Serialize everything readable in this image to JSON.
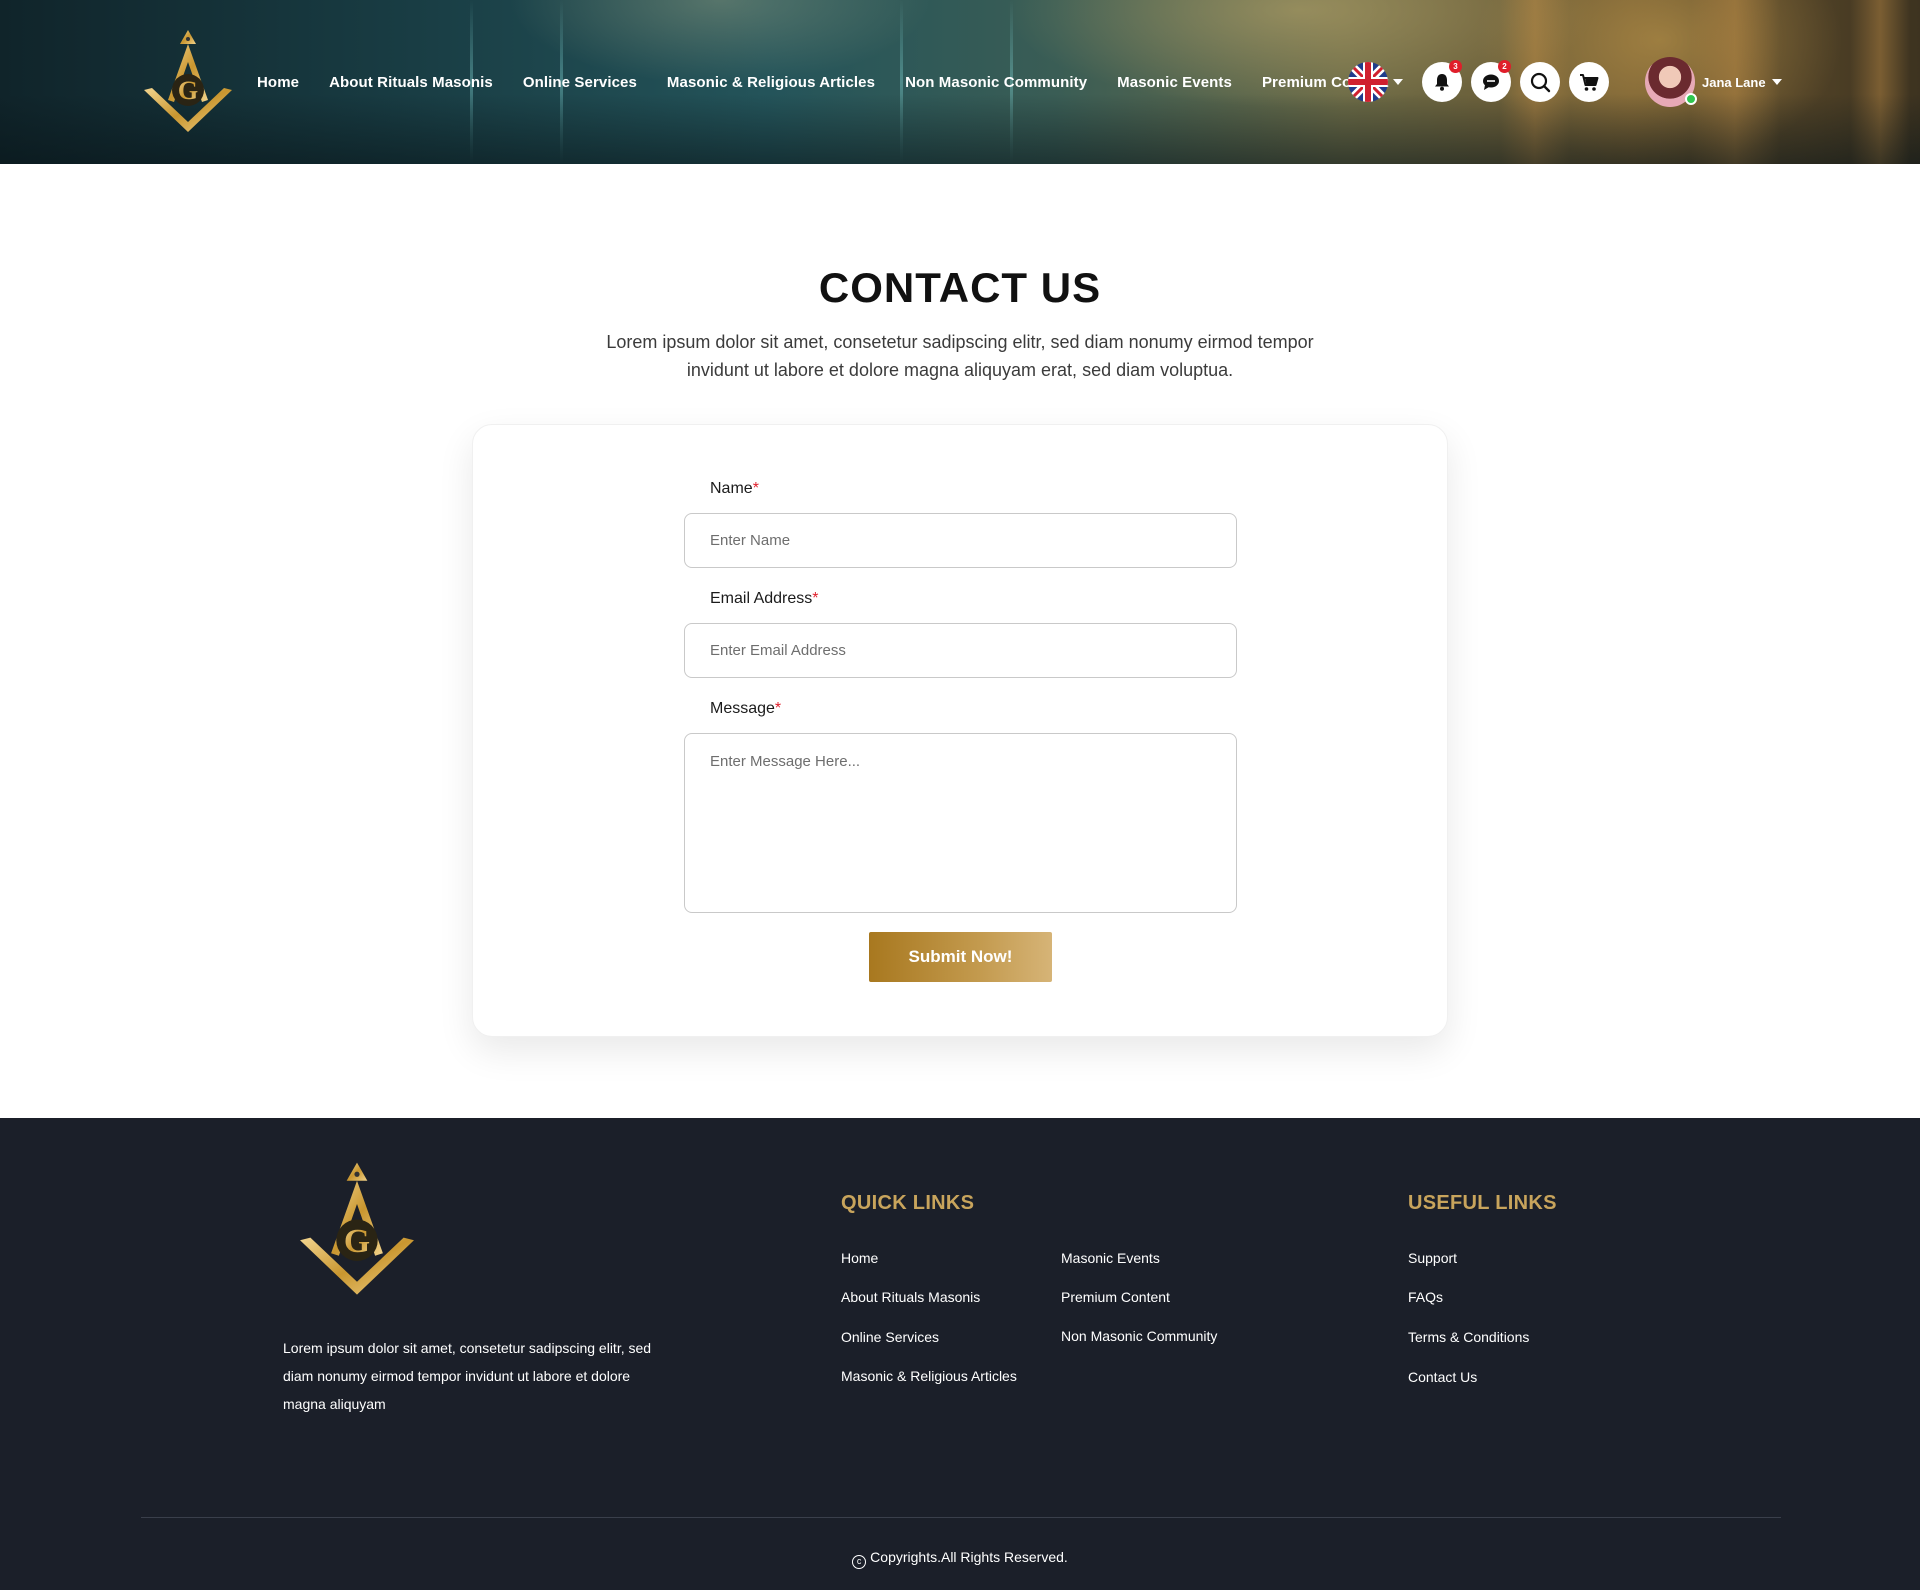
{
  "nav": {
    "items": [
      {
        "label": "Home"
      },
      {
        "label": "About Rituals Masonis"
      },
      {
        "label": "Online Services"
      },
      {
        "label": "Masonic & Religious Articles"
      },
      {
        "label": "Non Masonic Community"
      },
      {
        "label": "Masonic Events"
      },
      {
        "label": "Premium Content"
      }
    ],
    "language_icon": "uk-flag-icon",
    "notifications_count": "3",
    "messages_count": "2",
    "user_name": "Jana Lane",
    "user_status_color": "#2fc64f"
  },
  "main": {
    "title": "CONTACT US",
    "lead": "Lorem ipsum dolor sit amet, consetetur sadipscing elitr, sed diam nonumy eirmod tempor invidunt ut labore et dolore magna aliquyam erat, sed diam voluptua.",
    "form": {
      "name_label": "Name",
      "name_placeholder": "Enter Name",
      "email_label": "Email Address",
      "email_placeholder": "Enter Email Address",
      "message_label": "Message",
      "message_placeholder": "Enter Message Here...",
      "required_mark": "*",
      "submit_label": "Submit Now!"
    }
  },
  "footer": {
    "about": "Lorem ipsum dolor sit amet, consetetur sadipscing elitr, sed diam nonumy eirmod tempor invidunt ut labore et dolore magna aliquyam",
    "quick_links": {
      "heading": "QUICK LINKS",
      "col1": [
        "Home",
        "About Rituals Masonis",
        "Online Services",
        "Masonic & Religious Articles"
      ],
      "col2": [
        "Masonic Events",
        "Premium Content",
        "Non Masonic Community"
      ]
    },
    "useful_links": {
      "heading": "USEFUL LINKS",
      "items": [
        "Support",
        "FAQs",
        "Terms & Conditions",
        "Contact Us"
      ]
    },
    "copyright": "Copyrights.All Rights Reserved."
  },
  "colors": {
    "accent_gold": "#c8a45c",
    "button_gold": "#a8781f",
    "footer_bg": "#1b1f29",
    "required": "#e01e2a"
  }
}
